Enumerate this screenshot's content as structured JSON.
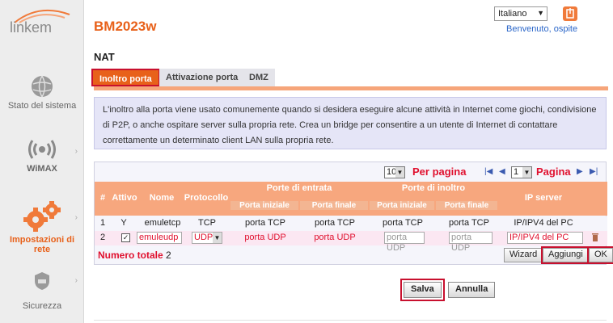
{
  "brand": {
    "logo_text": "linkem"
  },
  "header": {
    "app_title": "BM2023w",
    "language": "Italiano",
    "welcome": "Benvenuto, ospite"
  },
  "sidebar": {
    "items": [
      {
        "label": "Stato del sistema",
        "icon": "globe-icon"
      },
      {
        "label": "WiMAX",
        "icon": "wireless-icon"
      },
      {
        "label": "Impostazioni di rete",
        "icon": "gears-icon"
      },
      {
        "label": "Sicurezza",
        "icon": "shield-icon"
      }
    ]
  },
  "page": {
    "title": "NAT"
  },
  "tabs": [
    {
      "label": "Inoltro porta",
      "active": true
    },
    {
      "label": "Attivazione porta",
      "active": false
    },
    {
      "label": "DMZ",
      "active": false
    }
  ],
  "info": {
    "text": "L'inoltro alla porta viene usato comunemente quando si desidera eseguire alcune attività in Internet come giochi, condivisione di P2P, o anche ospitare server   sulla propria rete. Crea un bridge per consentire a un utente di Internet di contattare correttamente un determinato client LAN sulla propria rete."
  },
  "pager": {
    "per_page_value": "10",
    "per_page_label": "Per pagina",
    "page_value": "1",
    "page_label": "Pagina"
  },
  "table": {
    "headers": {
      "num": "#",
      "attivo": "Attivo",
      "nome": "Nome",
      "protocollo": "Protocollo",
      "porte_entrata": "Porte di entrata",
      "porte_inoltro": "Porte di inoltro",
      "ip_server": "IP server",
      "porta_iniziale": "Porta iniziale",
      "porta_finale": "Porta finale",
      "porta_iniziale_2": "Porta iniziale",
      "porta_finale_2": "Porta finale"
    },
    "rows": [
      {
        "num": "1",
        "attivo": "Y",
        "nome": "emuletcp",
        "protocollo": "TCP",
        "in_start": "porta TCP",
        "in_end": "porta TCP",
        "fw_start": "porta TCP",
        "fw_end": "porta TCP",
        "ip": "IP/IPV4 del PC"
      },
      {
        "num": "2",
        "attivo": "✓",
        "nome": "emuleudp",
        "protocollo": "UDP",
        "in_start": "porta UDP",
        "in_end": "porta UDP",
        "fw_start": "porta UDP",
        "fw_end": "porta UDP",
        "ip": "IP/IPV4 del PC"
      }
    ],
    "total_label": "Numero totale",
    "total_value": "2"
  },
  "buttons": {
    "wizard": "Wizard",
    "add": "Aggiungi",
    "ok": "OK",
    "save": "Salva",
    "cancel": "Annulla"
  },
  "colors": {
    "accent": "#e8611a",
    "highlight": "#c8102e",
    "table_header": "#f7a77e"
  }
}
